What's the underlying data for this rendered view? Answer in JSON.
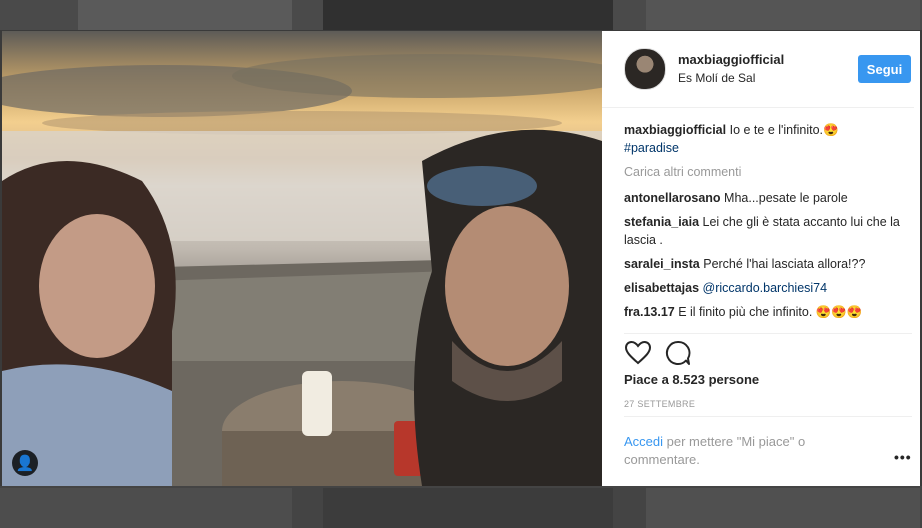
{
  "post": {
    "username": "maxbiaggiofficial",
    "location": "Es Molí de Sal",
    "follow_label": "Segui",
    "caption_user": "maxbiaggiofficial",
    "caption_text": "Io e te e l'infinito.😍",
    "hashtag": "#paradise",
    "load_more": "Carica altri commenti"
  },
  "comments": [
    {
      "user": "antonellarosano",
      "text": "Mha...pesate le parole"
    },
    {
      "user": "stefania_iaia",
      "text": "Lei che gli è stata accanto lui che la lascia ."
    },
    {
      "user": "saralei_insta",
      "text": "Perché l'hai lasciata allora!??"
    },
    {
      "user": "elisabettajas",
      "mention": "@riccardo.barchiesi74"
    },
    {
      "user": "fra.13.17",
      "text": "E il finito più che infinito. 😍😍😍"
    }
  ],
  "footer": {
    "likes": "Piace a 8.523 persone",
    "date": "27 SETTEMBRE",
    "login_link": "Accedi",
    "login_rest": " per mettere \"Mi piace\" o commentare.",
    "more": "•••"
  },
  "photo": {
    "tag_icon": "user-icon"
  },
  "colors": {
    "accent": "#3897f0",
    "link": "#003569",
    "muted": "#999999"
  }
}
